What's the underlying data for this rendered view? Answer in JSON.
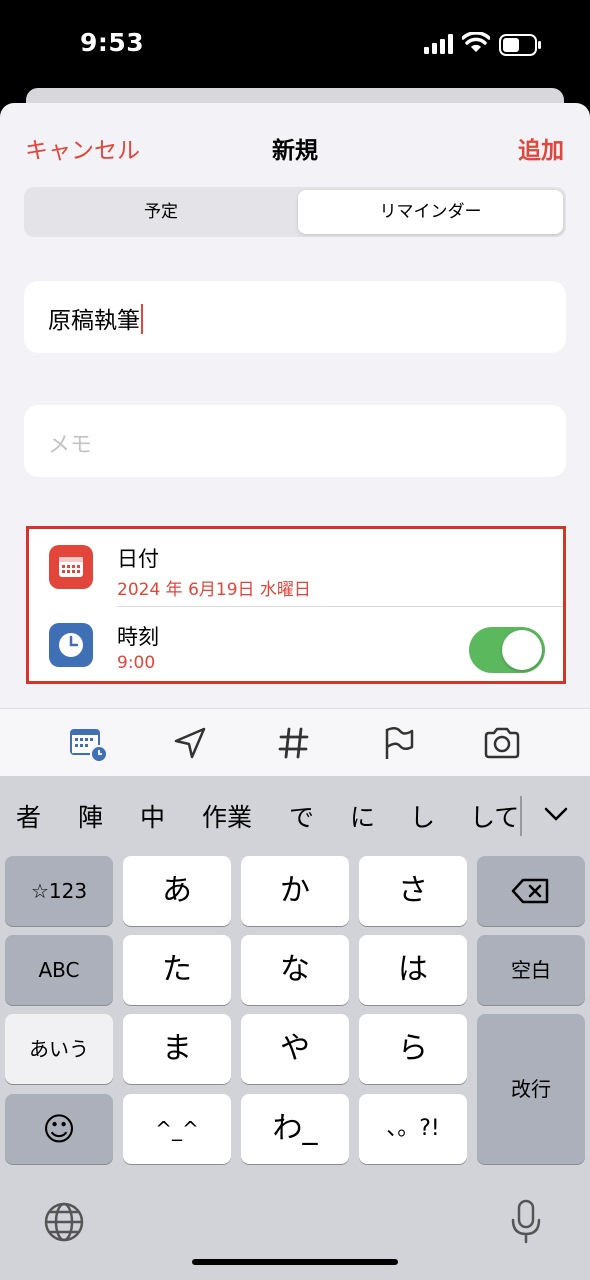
{
  "status_bar": {
    "time": "9:53"
  },
  "nav": {
    "cancel": "キャンセル",
    "title": "新規",
    "add": "追加"
  },
  "segmented": {
    "options": [
      "予定",
      "リマインダー"
    ],
    "selected": "リマインダー"
  },
  "form": {
    "title_value": "原稿執筆",
    "memo_placeholder": "メモ",
    "date_label": "日付",
    "date_value": "2024 年 6月19日 水曜日",
    "time_label": "時刻",
    "time_value": "9:00",
    "time_enabled": true
  },
  "toolbar_icons": [
    "calendar-clock-icon",
    "location-arrow-icon",
    "hashtag-icon",
    "flag-icon",
    "camera-icon"
  ],
  "candidates": [
    "者",
    "陣",
    "中",
    "作業",
    "で",
    "に",
    "し",
    "して"
  ],
  "keyboard": {
    "k123": "☆123",
    "a": "あ",
    "ka": "か",
    "sa": "さ",
    "abc": "ABC",
    "ta": "た",
    "na": "な",
    "ha": "は",
    "space": "空白",
    "aiu": "あいう",
    "ma": "ま",
    "ya": "や",
    "ra": "ら",
    "return": "改行",
    "emoji": "☺",
    "hat": "^_^",
    "wa": "わ_",
    "punct": "、。?!"
  },
  "colors": {
    "accent": "#e2453a",
    "toggle_on": "#5cb85c",
    "highlight_border": "#d2362b"
  }
}
